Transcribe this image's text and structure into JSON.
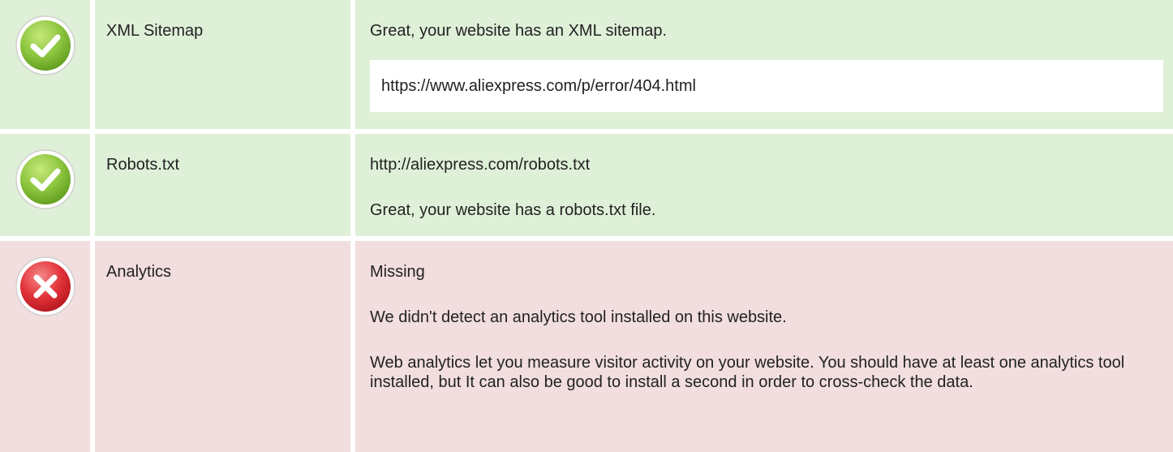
{
  "rows": [
    {
      "status": "pass",
      "icon": "check-icon",
      "label": "XML Sitemap",
      "message": "Great, your website has an XML sitemap.",
      "url": "https://www.aliexpress.com/p/error/404.html"
    },
    {
      "status": "pass",
      "icon": "check-icon",
      "label": "Robots.txt",
      "url": "http://aliexpress.com/robots.txt",
      "message": "Great, your website has a robots.txt file."
    },
    {
      "status": "fail",
      "icon": "cross-icon",
      "label": "Analytics",
      "value": "Missing",
      "message": "We didn't detect an analytics tool installed on this website.",
      "detail": "Web analytics let you measure visitor activity on your website. You should have at least one analytics tool installed, but It can also be good to install a second in order to cross-check the data."
    }
  ],
  "colors": {
    "pass_bg": "#dff0d8",
    "fail_bg": "#f2dede",
    "pass_icon": "#8dc63f",
    "fail_icon": "#e2333b"
  }
}
